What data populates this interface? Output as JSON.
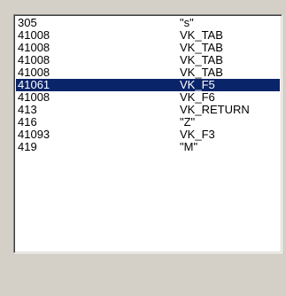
{
  "list": {
    "rows": [
      {
        "code": "305",
        "key": "\"s\"",
        "selected": false
      },
      {
        "code": "41008",
        "key": "VK_TAB",
        "selected": false
      },
      {
        "code": "41008",
        "key": "VK_TAB",
        "selected": false
      },
      {
        "code": "41008",
        "key": "VK_TAB",
        "selected": false
      },
      {
        "code": "41008",
        "key": "VK_TAB",
        "selected": false
      },
      {
        "code": "41061",
        "key": "VK_F5",
        "selected": true
      },
      {
        "code": "41008",
        "key": "VK_F6",
        "selected": false
      },
      {
        "code": "413",
        "key": "VK_RETURN",
        "selected": false
      },
      {
        "code": "416",
        "key": "\"Z\"",
        "selected": false
      },
      {
        "code": "41093",
        "key": "VK_F3",
        "selected": false
      },
      {
        "code": "419",
        "key": "\"M\"",
        "selected": false
      }
    ],
    "selection_color": "#0a246a",
    "selection_text_color": "#ffffff"
  }
}
